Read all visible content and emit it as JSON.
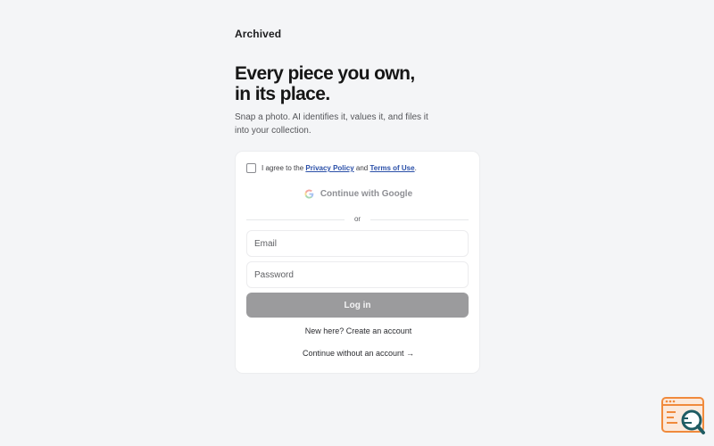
{
  "brand": "Archived",
  "hero": {
    "line1": "Every piece you own,",
    "line2": "in its place.",
    "subtitle": "Snap a photo. AI identifies it, values it, and files it into your collection."
  },
  "auth": {
    "agree_prefix": "I agree to the",
    "privacy_link": "Privacy Policy",
    "agree_and": "and",
    "terms_link": "Terms of Use",
    "agree_suffix": ".",
    "google_button": "Continue with Google",
    "divider": "or",
    "email_placeholder": "Email",
    "password_placeholder": "Password",
    "login_button": "Log in",
    "create_account": "New here? Create an account",
    "continue_guest": "Continue without an account →"
  },
  "colors": {
    "background": "#f4f5f7",
    "link": "#2a4fa8",
    "disabled_button": "#9b9b9d",
    "widget_accent": "#f08a3c"
  },
  "icons": {
    "google": "google-g-icon",
    "widget": "feedback-search-icon"
  }
}
